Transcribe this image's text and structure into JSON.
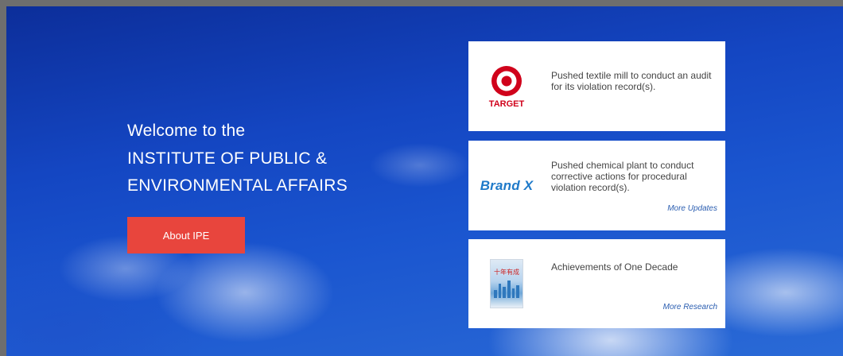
{
  "hero": {
    "welcome": "Welcome to the",
    "org_line1": "INSTITUTE OF PUBLIC &",
    "org_line2": "ENVIRONMENTAL AFFAIRS",
    "about_button": "About IPE"
  },
  "cards": [
    {
      "logo": "target-logo",
      "logo_text": "TARGET",
      "text": "Pushed textile mill to conduct an audit for its violation record(s).",
      "link": ""
    },
    {
      "logo": "brandx-logo",
      "logo_text": "Brand X",
      "text": "Pushed chemical plant to conduct corrective actions for procedural violation record(s).",
      "link": "More Updates"
    },
    {
      "logo": "report-cover-image",
      "logo_text": "十年有成",
      "text": "Achievements of One Decade",
      "link": "More Research"
    }
  ],
  "colors": {
    "accent_button": "#e8453d",
    "link": "#2a5db0",
    "target_red": "#d0021b",
    "brandx_blue": "#1f7ac9"
  }
}
